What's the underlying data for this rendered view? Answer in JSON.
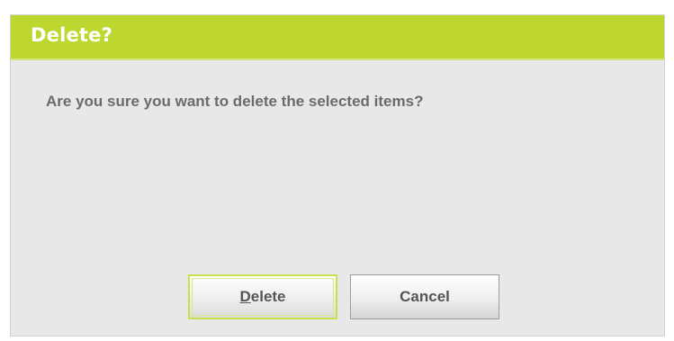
{
  "dialog": {
    "title": "Delete?",
    "message": "Are you sure you want to delete the selected items?",
    "title_bar_color": "#bed630",
    "background_color": "#e8e8e8"
  },
  "buttons": {
    "delete": {
      "mnemonic": "D",
      "rest": "elete",
      "focused": true
    },
    "cancel": {
      "label": "Cancel"
    }
  }
}
